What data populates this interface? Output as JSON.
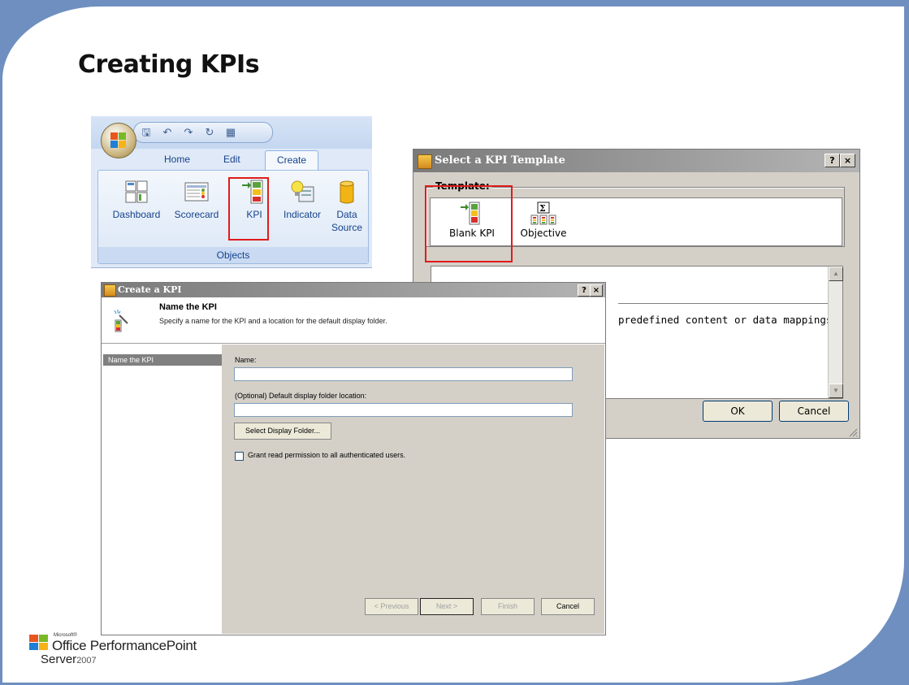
{
  "slide": {
    "title": "Creating KPIs"
  },
  "ribbon": {
    "tabs": [
      "Home",
      "Edit",
      "Create"
    ],
    "group_label": "Objects",
    "buttons": [
      {
        "label": "Dashboard",
        "icon": "dashboard-icon"
      },
      {
        "label": "Scorecard",
        "icon": "scorecard-icon"
      },
      {
        "label": "KPI",
        "icon": "kpi-icon"
      },
      {
        "label": "Indicator",
        "icon": "indicator-icon"
      },
      {
        "label": "Data Source",
        "icon": "data-source-icon"
      }
    ]
  },
  "template_dialog": {
    "title": "Select a KPI Template",
    "help": "?",
    "close": "×",
    "template_label": "Template:",
    "templates": [
      {
        "label": "Blank KPI",
        "icon": "blank-kpi-icon"
      },
      {
        "label": "Objective",
        "icon": "objective-icon"
      }
    ],
    "description": "predefined content or data mappings.",
    "ok": "OK",
    "cancel": "Cancel"
  },
  "create_dialog": {
    "title": "Create a KPI",
    "help": "?",
    "close": "×",
    "header_title": "Name the KPI",
    "header_subtitle": "Specify a name for the KPI and a location for the default display folder.",
    "nav_selected": "Name the KPI",
    "name_label": "Name:",
    "name_value": "",
    "folder_label": "(Optional) Default display folder location:",
    "folder_value": "",
    "select_folder_button": "Select Display Folder...",
    "grant_checkbox_label": "Grant read permission to all authenticated users.",
    "grant_checked": false,
    "previous": "< Previous",
    "next": "Next >",
    "finish": "Finish",
    "cancel": "Cancel"
  },
  "logo": {
    "microsoft": "Microsoft®",
    "product": "Office PerformancePoint",
    "server": "Server",
    "year": "2007"
  },
  "colors": {
    "highlight_red": "#e01b1b",
    "ribbon_blue": "#15428b",
    "slide_frame": "#6e8fc0"
  }
}
